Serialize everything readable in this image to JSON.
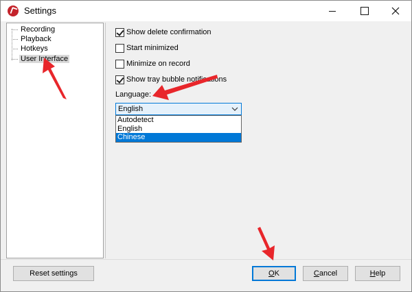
{
  "window": {
    "title": "Settings"
  },
  "tree": {
    "items": [
      {
        "label": "Recording",
        "selected": false
      },
      {
        "label": "Playback",
        "selected": false
      },
      {
        "label": "Hotkeys",
        "selected": false
      },
      {
        "label": "User Interface",
        "selected": true
      }
    ]
  },
  "options": {
    "show_delete_confirmation": {
      "label": "Show delete confirmation",
      "checked": true
    },
    "start_minimized": {
      "label": "Start minimized",
      "checked": false
    },
    "minimize_on_record": {
      "label": "Minimize on record",
      "checked": false
    },
    "show_tray_bubble": {
      "label": "Show tray bubble notifications",
      "checked": true
    }
  },
  "language": {
    "label": "Language:",
    "selected_value": "English",
    "dropdown_options": [
      "Autodetect",
      "English",
      "Chinese"
    ],
    "highlighted_option": "Chinese"
  },
  "buttons": {
    "reset": "Reset settings",
    "ok_prefix": "O",
    "ok_rest": "K",
    "cancel_prefix": "C",
    "cancel_rest": "ancel",
    "help_prefix": "H",
    "help_rest": "elp"
  },
  "colors": {
    "accent": "#0078d7",
    "annotation_arrow": "#e8262b",
    "app_icon": "#c4232b"
  },
  "icons": {
    "app": "app-logo-icon",
    "minimize": "minimize-icon",
    "maximize": "maximize-icon",
    "close": "close-icon",
    "dropdown": "chevron-down-icon"
  }
}
